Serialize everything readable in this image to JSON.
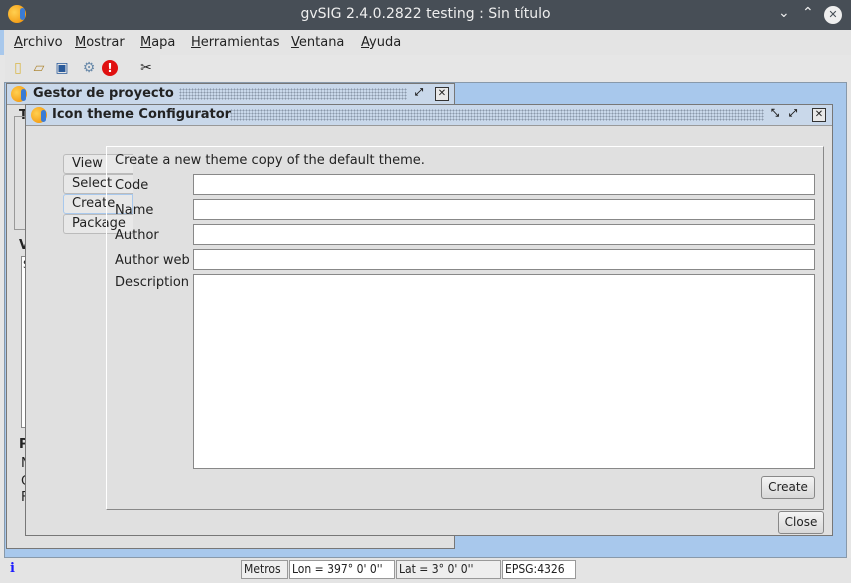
{
  "window": {
    "title": "gvSIG 2.4.0.2822 testing : Sin título",
    "minimize": "⌄",
    "maximize": "⌃",
    "close": "✕"
  },
  "menu": [
    {
      "label": "Archivo"
    },
    {
      "label": "Mostrar"
    },
    {
      "label": "Mapa"
    },
    {
      "label": "Herramientas"
    },
    {
      "label": "Ventana"
    },
    {
      "label": "Ayuda"
    }
  ],
  "toolbar": [
    {
      "icon": "new-project-icon"
    },
    {
      "icon": "open-project-icon"
    },
    {
      "icon": "save-project-icon"
    },
    {
      "icon": "preferences-icon"
    },
    {
      "icon": "error-icon"
    },
    {
      "icon": "tools-icon"
    }
  ],
  "project_manager": {
    "title": "Gestor de proyecto",
    "group_fragments": [
      "T",
      "V",
      "P"
    ],
    "row_fragments": [
      "N",
      "C",
      "F"
    ],
    "list_fragment": "S"
  },
  "icon_config": {
    "title": "Icon theme Configurator",
    "tabs": [
      {
        "label": "View"
      },
      {
        "label": "Select"
      },
      {
        "label": "Create",
        "selected": true
      },
      {
        "label": "Package"
      }
    ],
    "heading": "Create a new theme copy of the default theme.",
    "fields": {
      "code": {
        "label": "Code",
        "value": ""
      },
      "name": {
        "label": "Name",
        "value": ""
      },
      "author": {
        "label": "Author",
        "value": ""
      },
      "author_web": {
        "label": "Author web",
        "value": ""
      },
      "description": {
        "label": "Description",
        "value": ""
      }
    },
    "create_label": "Create",
    "close_label": "Close"
  },
  "status": {
    "info": "i",
    "units": "Metros",
    "lon": "Lon = 397° 0' 0''",
    "lat": "Lat = 3° 0' 0''",
    "crs": "EPSG:4326"
  },
  "colors": {
    "titlebar": "#474e56",
    "desktop": "#a8c8ec",
    "window_title": "#c9d8ea"
  }
}
